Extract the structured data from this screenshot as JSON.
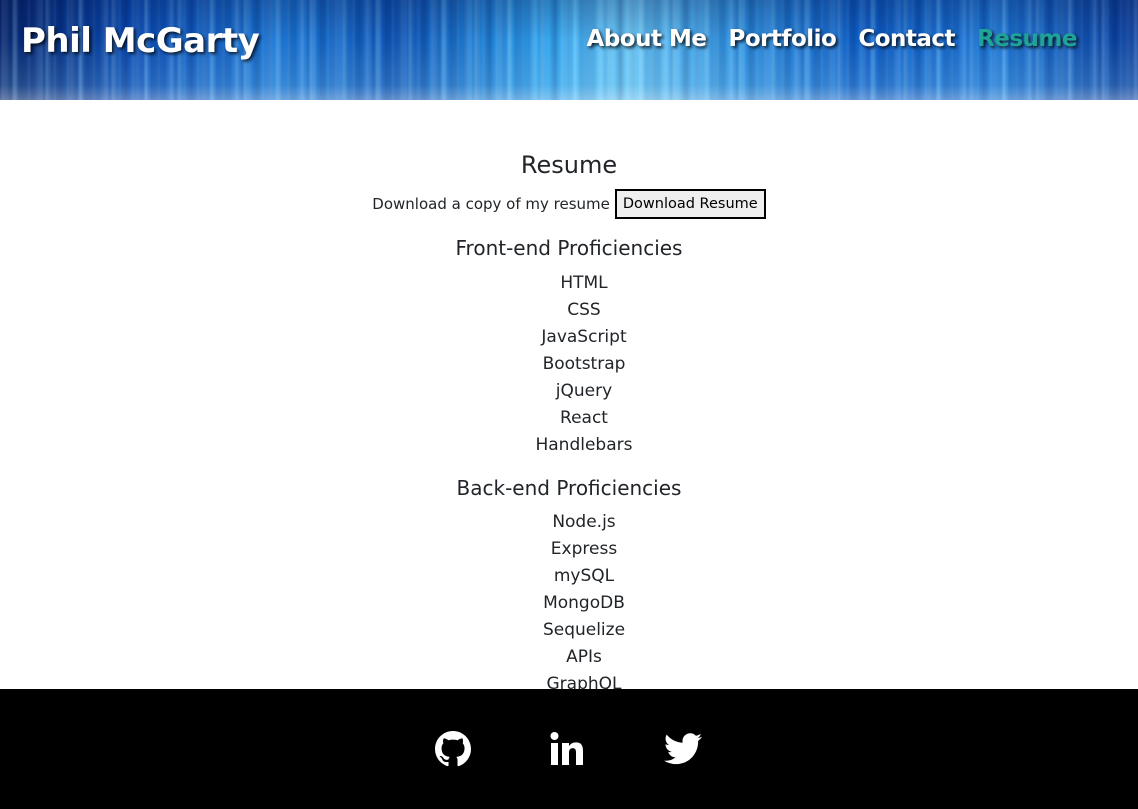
{
  "header": {
    "brand": "Phil McGarty",
    "nav": [
      {
        "label": "About Me"
      },
      {
        "label": "Portfolio"
      },
      {
        "label": "Contact"
      },
      {
        "label": "Resume",
        "active": true
      }
    ]
  },
  "resume": {
    "title": "Resume",
    "download_text": "Download a copy of my resume",
    "download_button": "Download Resume",
    "frontend": {
      "title": "Front-end Proficiencies",
      "items": [
        "HTML",
        "CSS",
        "JavaScript",
        "Bootstrap",
        "jQuery",
        "React",
        "Handlebars"
      ]
    },
    "backend": {
      "title": "Back-end Proficiencies",
      "items": [
        "Node.js",
        "Express",
        "mySQL",
        "MongoDB",
        "Sequelize",
        "APIs",
        "GraphQL"
      ]
    }
  },
  "footer": {
    "icons": [
      "github-icon",
      "linkedin-icon",
      "twitter-icon"
    ]
  },
  "colors": {
    "active_nav": "#1fa396",
    "footer_bg": "#000000",
    "text": "#212529"
  }
}
